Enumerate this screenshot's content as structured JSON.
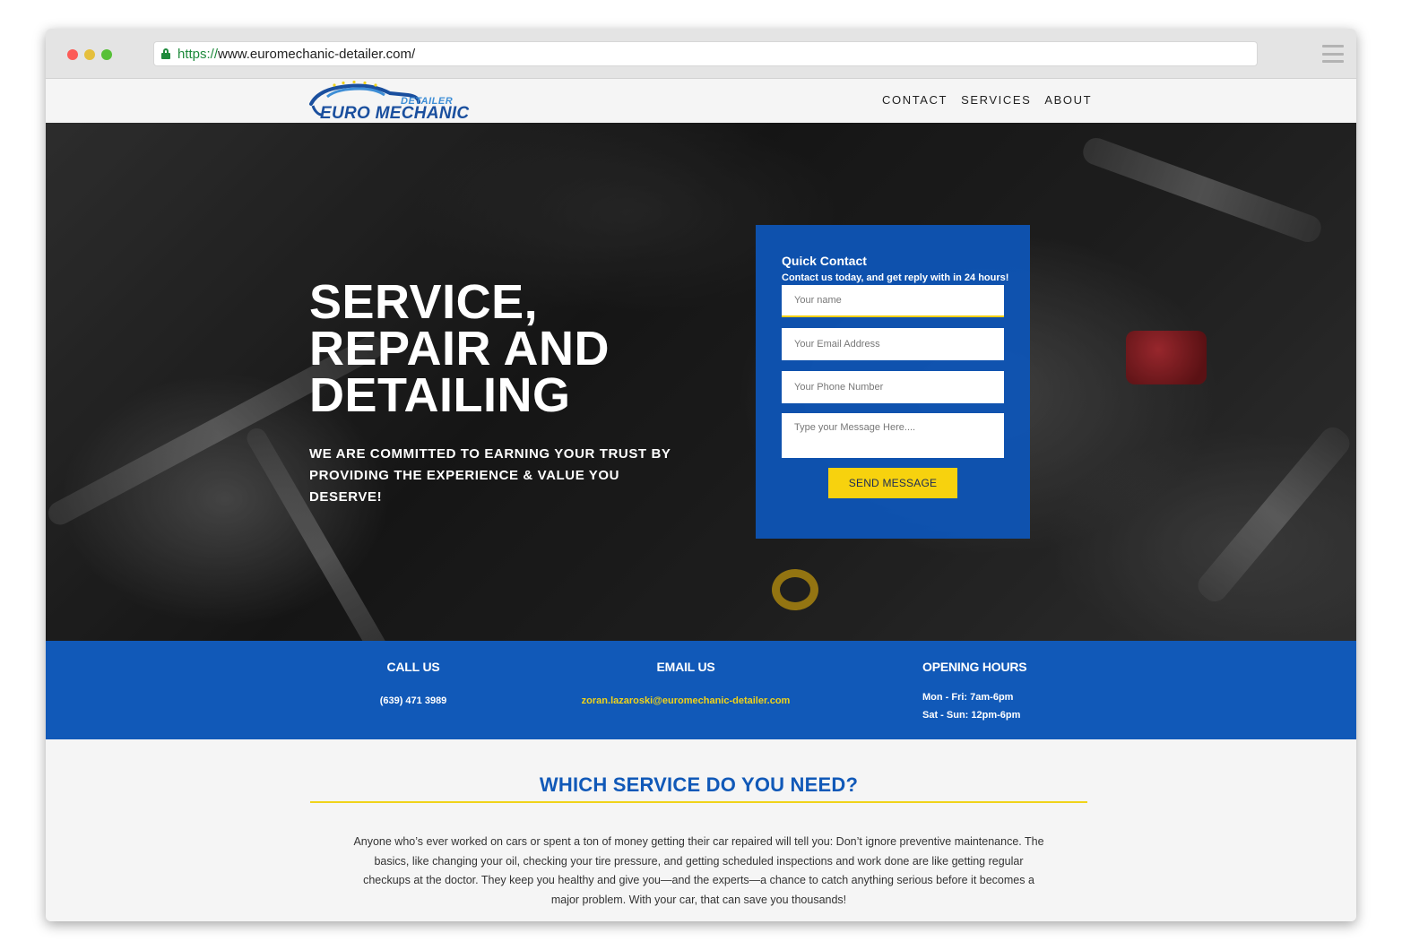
{
  "browser": {
    "url_scheme": "https://",
    "url_rest": "www.euromechanic-detailer.com/",
    "icons": [
      "lock-icon",
      "menu-icon"
    ]
  },
  "header": {
    "logo_top": "DETAILER",
    "logo_main": "EURO MECHANIC",
    "nav": [
      "CONTACT",
      "SERVICES",
      "ABOUT"
    ]
  },
  "hero": {
    "title": "SERVICE, REPAIR AND DETAILING",
    "subtitle": "WE ARE COMMITTED TO EARNING YOUR TRUST BY PROVIDING THE EXPERIENCE & VALUE YOU DESERVE!"
  },
  "quick_contact": {
    "title": "Quick Contact",
    "subtitle": "Contact us today, and get reply with in 24 hours!",
    "name_placeholder": "Your name",
    "email_placeholder": "Your Email Address",
    "phone_placeholder": "Your Phone Number",
    "message_placeholder": "Type your Message Here....",
    "send_label": "SEND MESSAGE"
  },
  "info": {
    "call_title": "CALL US",
    "phone": "(639) 471 3989",
    "email_title": "EMAIL US",
    "email": "zoran.lazaroski@euromechanic-detailer.com",
    "hours_title": "OPENING HOURS",
    "hours_weekday": "Mon - Fri: 7am-6pm",
    "hours_weekend": "Sat - Sun: 12pm-6pm"
  },
  "services": {
    "heading": "WHICH SERVICE DO YOU NEED?",
    "lead": "Anyone who’s ever worked on cars or spent a ton of money getting their car repaired will tell you: Don’t ignore preventive maintenance. The basics, like changing your oil, checking your tire pressure, and getting scheduled inspections and work done are like getting regular checkups at the doctor. They keep you healthy and give you—and the experts—a chance to catch anything serious before it becomes a major problem. With your car, that can save you thousands!"
  },
  "colors": {
    "brand_blue": "#1159b8",
    "accent_yellow": "#f7d20e"
  }
}
